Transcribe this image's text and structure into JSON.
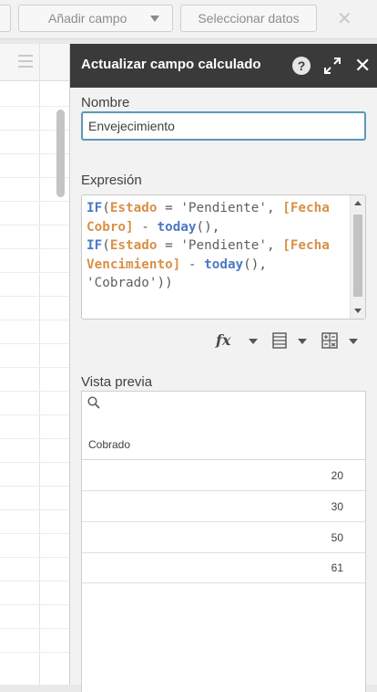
{
  "toolbar": {
    "add_field_label": "Añadir campo",
    "select_data_label": "Seleccionar datos",
    "close_symbol": "✕"
  },
  "panel": {
    "title": "Actualizar campo calculado",
    "help_symbol": "?",
    "close_symbol": "✕",
    "name_label": "Nombre",
    "name_value": "Envejecimiento",
    "expression_label": "Expresión",
    "expression": {
      "line1_kw": "IF",
      "line1_open": "(",
      "line1_field1": "Estado",
      "line1_eq": " = ",
      "line1_str": "'Pendiente'",
      "line1_comma": ", ",
      "line1_field2": "[Fecha",
      "line2_field2": "Cobro]",
      "line2_minus": " - ",
      "line2_fn": "today",
      "line2_tail": "(),",
      "line3_kw": "IF",
      "line3_open": "(",
      "line3_field1": "Estado",
      "line3_eq": " = ",
      "line3_str": "'Pendiente'",
      "line3_comma": ", ",
      "line3_field2": "[Fecha",
      "line4_field2": "Vencimiento]",
      "line4_minus": " - ",
      "line4_fn": "today",
      "line4_tail": "(),",
      "line5_str": "'Cobrado'",
      "line5_tail": "))"
    },
    "tools": {
      "fx_symbol": "fx"
    },
    "preview_label": "Vista previa",
    "preview": {
      "column_header": "Cobrado",
      "rows": [
        "20",
        "30",
        "50",
        "61"
      ]
    }
  }
}
